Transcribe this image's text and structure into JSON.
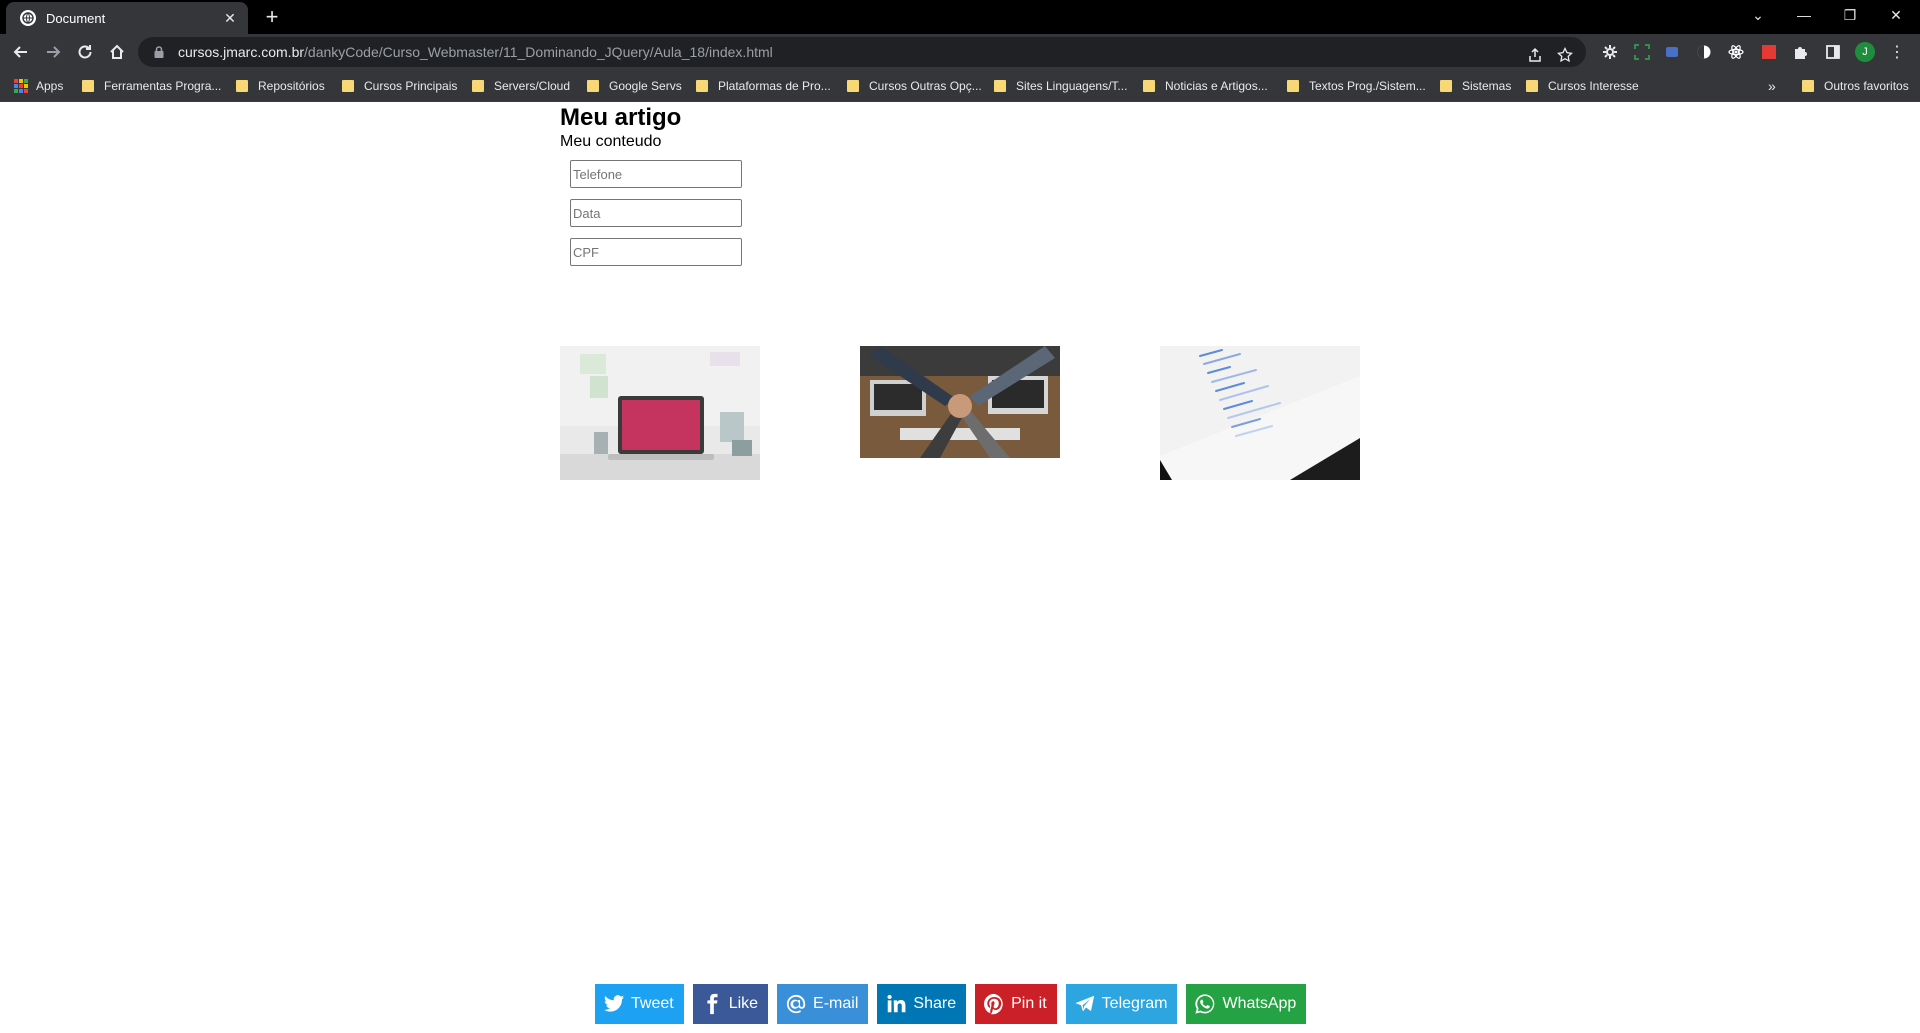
{
  "browser": {
    "tab_title": "Document",
    "url_host": "cursos.jmarc.com.br",
    "url_path": "/dankyCode/Curso_Webmaster/11_Dominando_JQuery/Aula_18/index.html",
    "profile_initial": "J",
    "bookmarks": [
      "Apps",
      "Ferramentas Progra...",
      "Repositórios",
      "Cursos Principais",
      "Servers/Cloud",
      "Google Servs",
      "Plataformas de Pro...",
      "Cursos Outras Opç...",
      "Sites Linguagens/T...",
      "Noticias e Artigos...",
      "Textos Prog./Sistem...",
      "Sistemas",
      "Cursos Interesse"
    ],
    "bookmarks_overflow": "»",
    "other_bookmarks": "Outros favoritos"
  },
  "page": {
    "title": "Meu artigo",
    "subtitle": "Meu conteudo",
    "inputs": {
      "phone_placeholder": "Telefone",
      "date_placeholder": "Data",
      "cpf_placeholder": "CPF"
    }
  },
  "share": {
    "tweet": "Tweet",
    "like": "Like",
    "email": "E-mail",
    "share": "Share",
    "pin": "Pin it",
    "telegram": "Telegram",
    "whatsapp": "WhatsApp"
  },
  "colors": {
    "twitter": "#1da1f2",
    "facebook": "#3b5998",
    "email": "#3a8fd9",
    "linkedin": "#0077b5",
    "pinterest": "#cb2027",
    "telegram": "#2ca5e0",
    "whatsapp": "#25a244"
  }
}
